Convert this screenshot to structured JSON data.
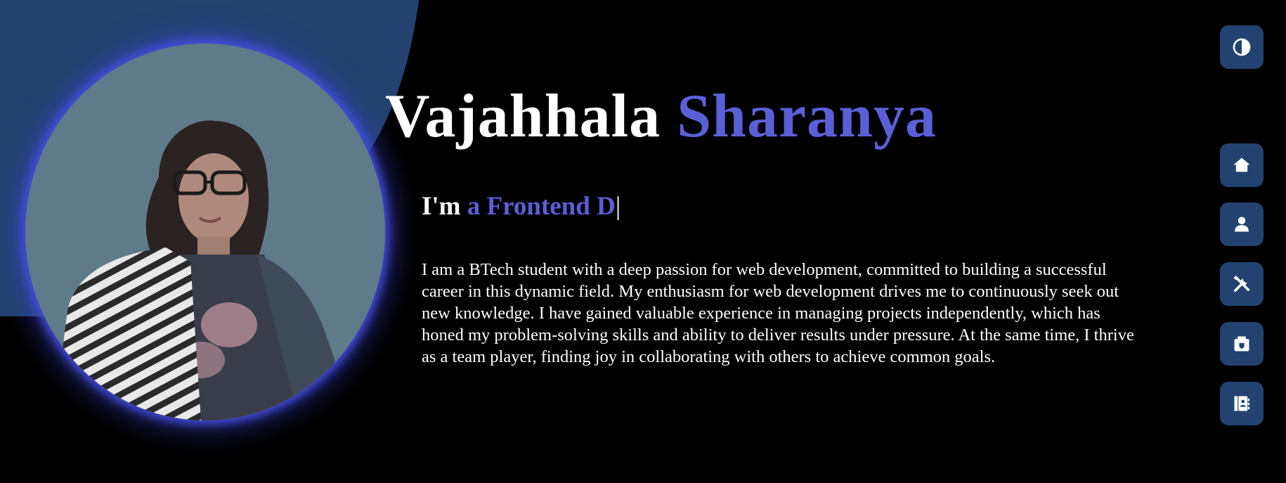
{
  "hero": {
    "first_name": "Vajahhala",
    "last_name": "Sharanya",
    "typing_prefix": "I'm",
    "typing_text": "a Frontend D",
    "typing_cursor": "|",
    "bio": "I am a BTech student with a deep passion for web development, committed to building a successful career in this dynamic field. My enthusiasm for web development drives me to continuously seek out new knowledge. I have gained valuable experience in managing projects independently, which has honed my problem-solving skills and ability to deliver results under pressure. At the same time, I thrive as a team player, finding joy in collaborating with others to achieve common goals."
  },
  "nav": {
    "items": [
      {
        "id": "theme",
        "icon": "contrast-icon"
      },
      {
        "id": "home",
        "icon": "home-icon"
      },
      {
        "id": "about",
        "icon": "user-icon"
      },
      {
        "id": "skills",
        "icon": "tools-icon"
      },
      {
        "id": "projects",
        "icon": "briefcase-icon"
      },
      {
        "id": "contact",
        "icon": "contact-book-icon"
      }
    ]
  },
  "colors": {
    "background": "#000000",
    "accent": "#5b5fd6",
    "nav_button": "#23426f",
    "decor_shape": "#23426f",
    "photo_glow": "#4650e6"
  }
}
